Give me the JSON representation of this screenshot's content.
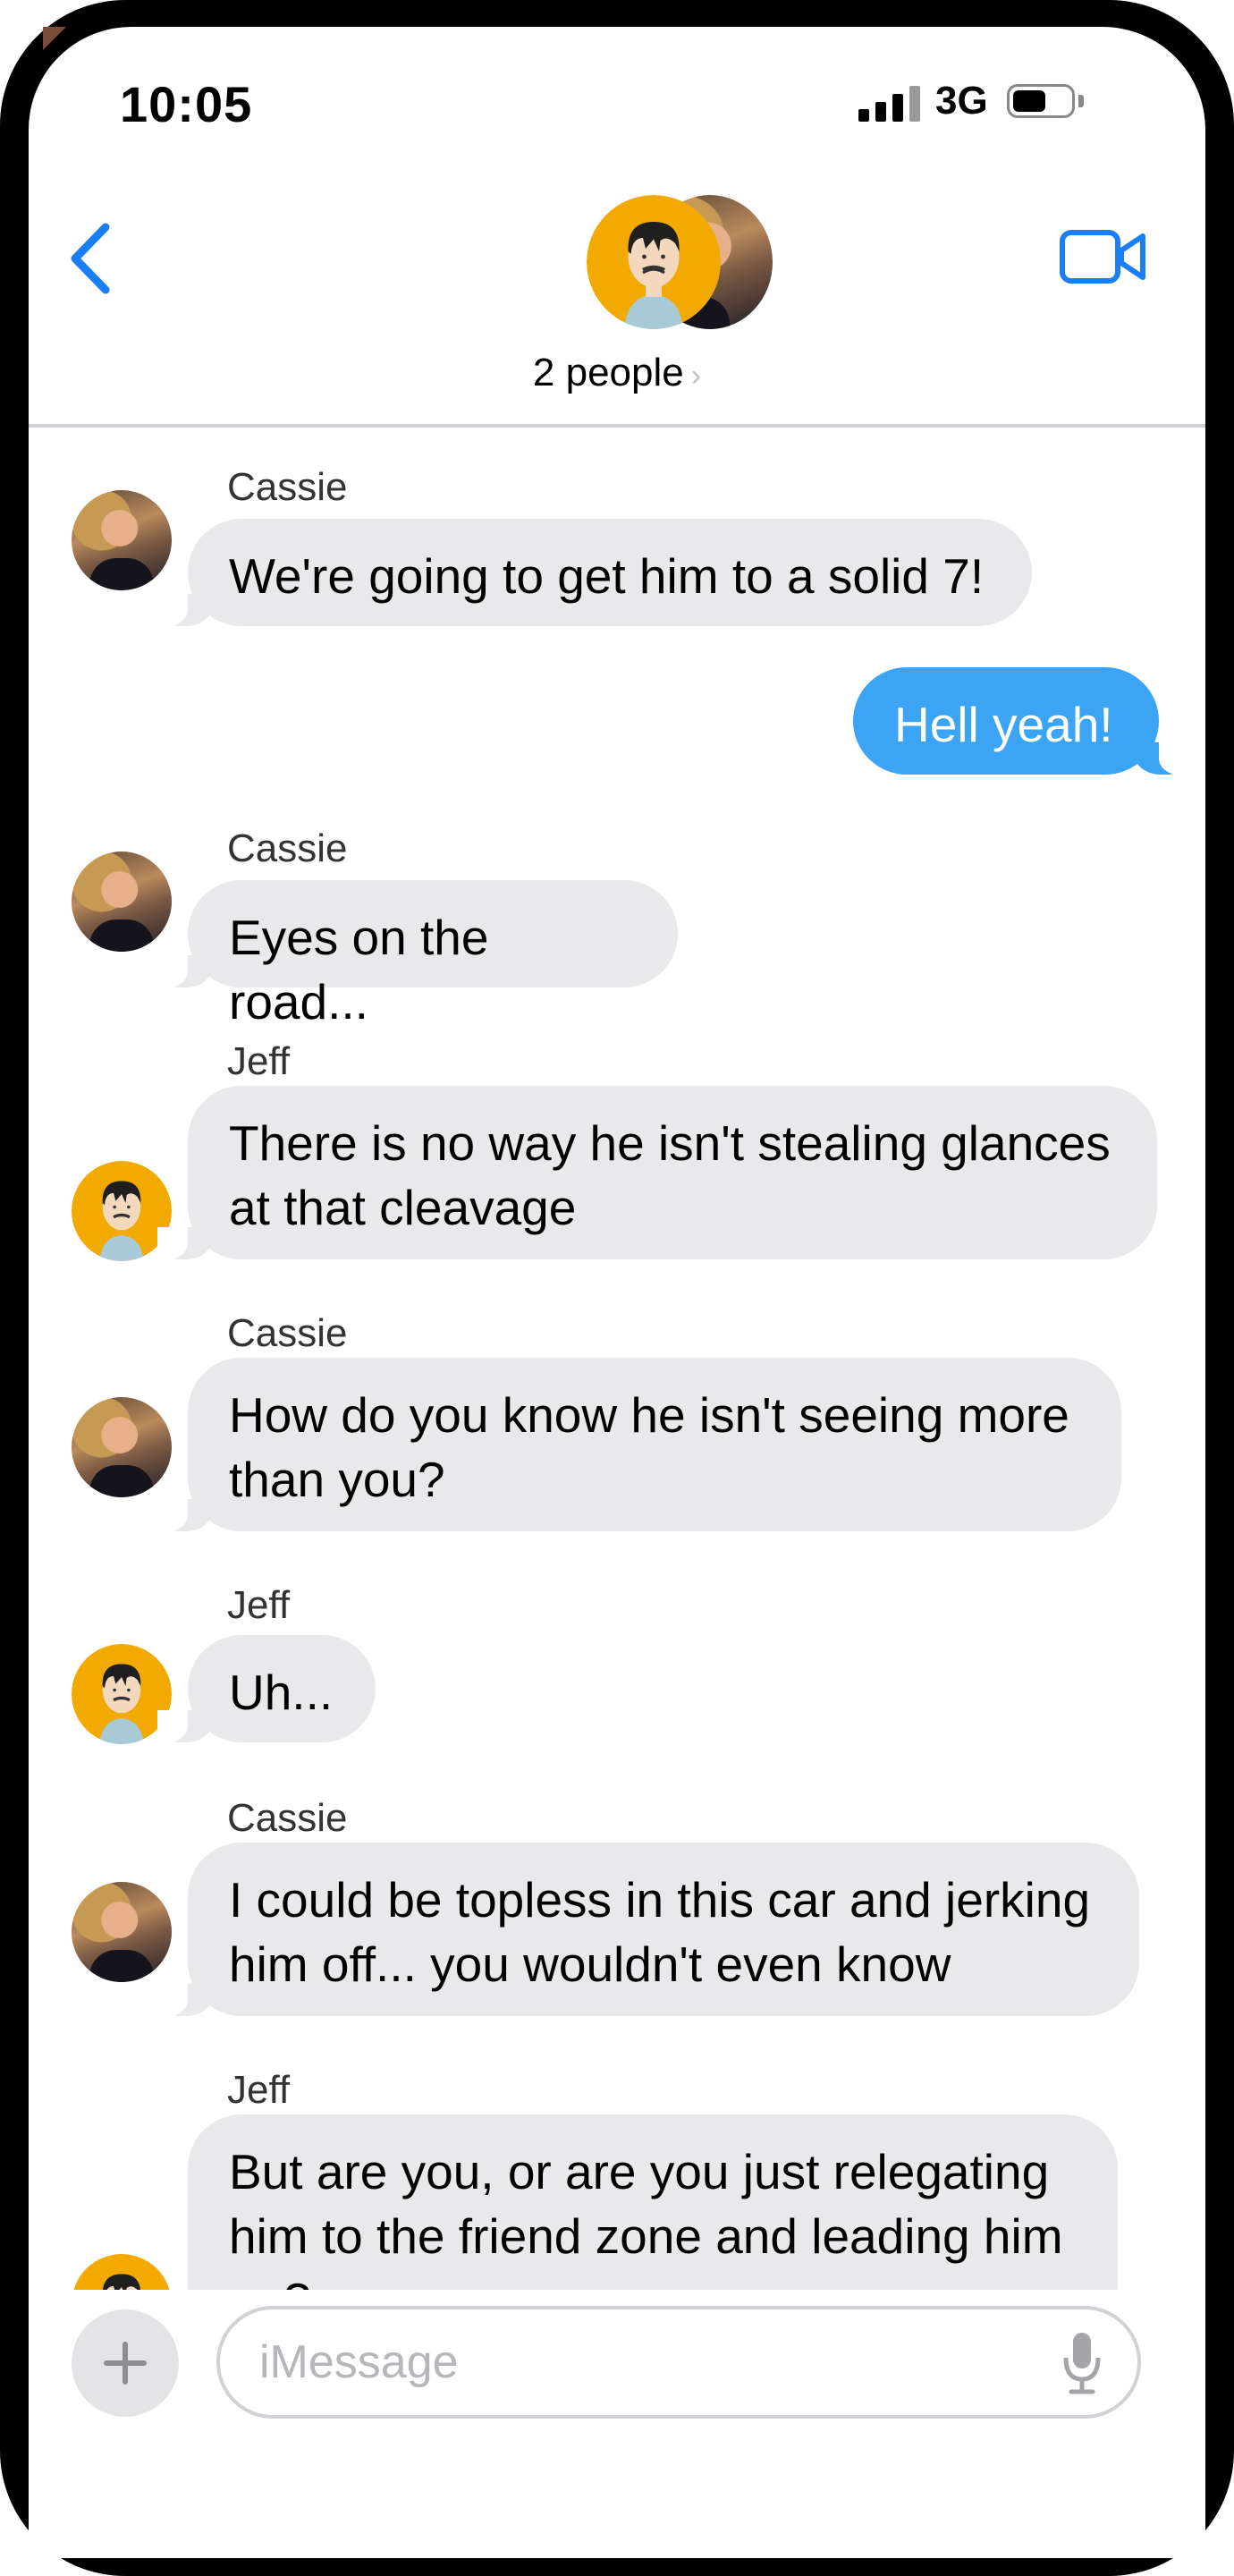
{
  "status_bar": {
    "time": "10:05",
    "network": "3G"
  },
  "header": {
    "subtitle": "2 people",
    "chevron": "›"
  },
  "messages": [
    {
      "sender": "Cassie",
      "text": "We're going to get him to a solid 7!"
    },
    {
      "text": "Hell yeah!"
    },
    {
      "sender": "Cassie",
      "text": "Eyes on the road..."
    },
    {
      "sender": "Jeff",
      "text": "There is no way he isn't stealing glances at that cleavage"
    },
    {
      "sender": "Cassie",
      "text": "How do you know he isn't seeing more than you?"
    },
    {
      "sender": "Jeff",
      "text": "Uh..."
    },
    {
      "sender": "Cassie",
      "text": "I could be topless in this car and jerking him off... you wouldn't even know"
    },
    {
      "sender": "Jeff",
      "text": "But are you, or are you just relegating him to the friend zone and leading him on?"
    }
  ],
  "input": {
    "placeholder": "iMessage"
  },
  "icons": {
    "back": "chevron-left-icon",
    "video": "video-camera-icon",
    "plus": "plus-icon",
    "mic": "microphone-icon"
  },
  "colors": {
    "accent": "#1a7ef6",
    "outgoing_bubble": "#3ba4f4",
    "incoming_bubble": "#e9e9eb",
    "avatar_yellow": "#f2a900"
  }
}
